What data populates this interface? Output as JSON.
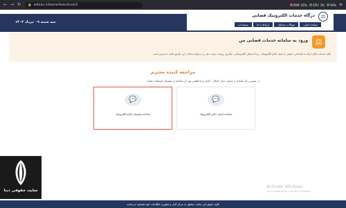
{
  "browser": {
    "url": "adliran.ir/Home/SelectLink/2",
    "stats": [
      {
        "label": "RAM: 85%",
        "color": "#e0534a"
      },
      {
        "label": "CPU: 3%",
        "color": "#3fa34d"
      },
      {
        "label": "94%",
        "color": "#3fa34d"
      }
    ]
  },
  "header": {
    "date": "سه شنبه ۰۹ مرداد ۱۴۰۳",
    "title": "درگاه خدمات الکترونیک قضایی",
    "nav": [
      "صفحه اصلی",
      "سوالات متداول",
      "ارتباط با ما",
      "مستندات"
    ]
  },
  "banner": {
    "title": "ورود به سامانه خدمات قضایی من",
    "text": "کلیه خدمات قابل ارائه به اشخاص حقیقی از قبیل ابلاغ الکترونیک، پرداخت‌های الکترونیکی، پیگیری پرونده، نوبت دهی و درخواست‌ها از این طریق قابل دسترس است"
  },
  "main": {
    "section_title": "مراجعه کننده محترم",
    "instruction": "در صورتی که سامانه ی اصلی دچار اختلال ، کندی و یا قطعی بود، از سامانه ی پشتیبان استفاده نمایید.",
    "cards": [
      {
        "label": "سامانه اصلی ابلاغ الکترونیک",
        "selected": false
      },
      {
        "label": "سامانه پشتیبان ابلاغ الکترونیک",
        "selected": true
      }
    ]
  },
  "watermark": {
    "site_name": "سایت حقوقی دینا"
  },
  "os_notice": {
    "title": "Activate Windows",
    "subtitle": "Go to Settings to activate Windows."
  },
  "footer": {
    "text": "کلیه حقوق این سایت متعلق به مرکز آمار و فناوری اطلاعات قوه قضاییه می‌باشد"
  }
}
